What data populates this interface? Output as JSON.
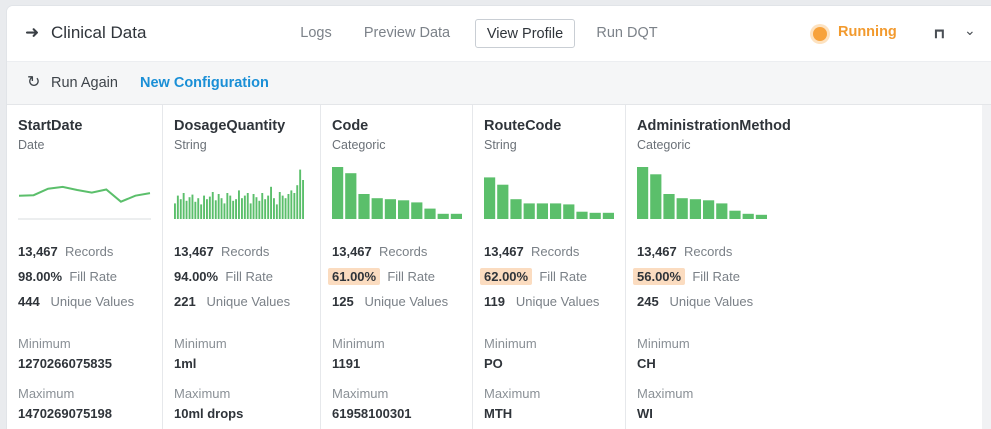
{
  "header": {
    "back_icon": "arrow-right-icon",
    "title": "Clinical Data",
    "tabs": [
      {
        "label": "Logs"
      },
      {
        "label": "Preview Data"
      },
      {
        "label": "View Profile"
      },
      {
        "label": "Run DQT"
      }
    ],
    "active_tab": "View Profile",
    "status": {
      "label": "Running",
      "color": "#f7a23b"
    },
    "expand_icon": "expand-icon",
    "chevron_icon": "chevron-down-icon"
  },
  "toolbar": {
    "run_again_icon": "refresh-icon",
    "run_again_label": "Run Again",
    "new_config_label": "New Configuration"
  },
  "columns": [
    {
      "name": "StartDate",
      "type": "Date",
      "chart": "line",
      "spark": [
        0.28,
        0.3,
        0.55,
        0.62,
        0.5,
        0.4,
        0.52,
        0.05,
        0.28,
        0.38
      ],
      "records": "13,467",
      "records_label": "Records",
      "fill": "98.00%",
      "fill_label": "Fill Rate",
      "fill_highlight": false,
      "unique": "444",
      "unique_label": "Unique Values",
      "min_label": "Minimum",
      "min": "1270266075835",
      "max_label": "Maximum",
      "max": "1470269075198"
    },
    {
      "name": "DosageQuantity",
      "type": "String",
      "chart": "bars",
      "spark": [
        0.3,
        0.45,
        0.38,
        0.5,
        0.35,
        0.42,
        0.47,
        0.33,
        0.4,
        0.28,
        0.45,
        0.38,
        0.43,
        0.52,
        0.36,
        0.48,
        0.4,
        0.3,
        0.5,
        0.45,
        0.35,
        0.38,
        0.55,
        0.4,
        0.45,
        0.5,
        0.3,
        0.48,
        0.42,
        0.35,
        0.5,
        0.38,
        0.45,
        0.62,
        0.4,
        0.28,
        0.52,
        0.45,
        0.4,
        0.48,
        0.55,
        0.5,
        0.65,
        0.95,
        0.75
      ],
      "records": "13,467",
      "records_label": "Records",
      "fill": "94.00%",
      "fill_label": "Fill Rate",
      "fill_highlight": false,
      "unique": "221",
      "unique_label": "Unique Values",
      "min_label": "Minimum",
      "min": "1ml",
      "max_label": "Maximum",
      "max": "10ml drops"
    },
    {
      "name": "Code",
      "type": "Categoric",
      "chart": "bars",
      "spark": [
        1.0,
        0.88,
        0.48,
        0.4,
        0.38,
        0.36,
        0.32,
        0.2,
        0.1,
        0.1
      ],
      "records": "13,467",
      "records_label": "Records",
      "fill": "61.00%",
      "fill_label": "Fill Rate",
      "fill_highlight": true,
      "unique": "125",
      "unique_label": "Unique Values",
      "min_label": "Minimum",
      "min": "1191",
      "max_label": "Maximum",
      "max": "61958100301"
    },
    {
      "name": "RouteCode",
      "type": "String",
      "chart": "bars",
      "spark": [
        0.8,
        0.66,
        0.38,
        0.3,
        0.3,
        0.3,
        0.28,
        0.14,
        0.12,
        0.12
      ],
      "records": "13,467",
      "records_label": "Records",
      "fill": "62.00%",
      "fill_label": "Fill Rate",
      "fill_highlight": true,
      "unique": "119",
      "unique_label": "Unique Values",
      "min_label": "Minimum",
      "min": "PO",
      "max_label": "Maximum",
      "max": "MTH"
    },
    {
      "name": "AdministrationMethod",
      "type": "Categoric",
      "chart": "bars",
      "spark": [
        1.0,
        0.86,
        0.48,
        0.4,
        0.38,
        0.36,
        0.3,
        0.16,
        0.1,
        0.08
      ],
      "records": "13,467",
      "records_label": "Records",
      "fill": "56.00%",
      "fill_label": "Fill Rate",
      "fill_highlight": true,
      "unique": "245",
      "unique_label": "Unique Values",
      "min_label": "Minimum",
      "min": "CH",
      "max_label": "Maximum",
      "max": "WI"
    }
  ],
  "colors": {
    "bar": "#5bbf6b",
    "highlight": "#fbdcc0",
    "accent": "#1a8fd6"
  }
}
